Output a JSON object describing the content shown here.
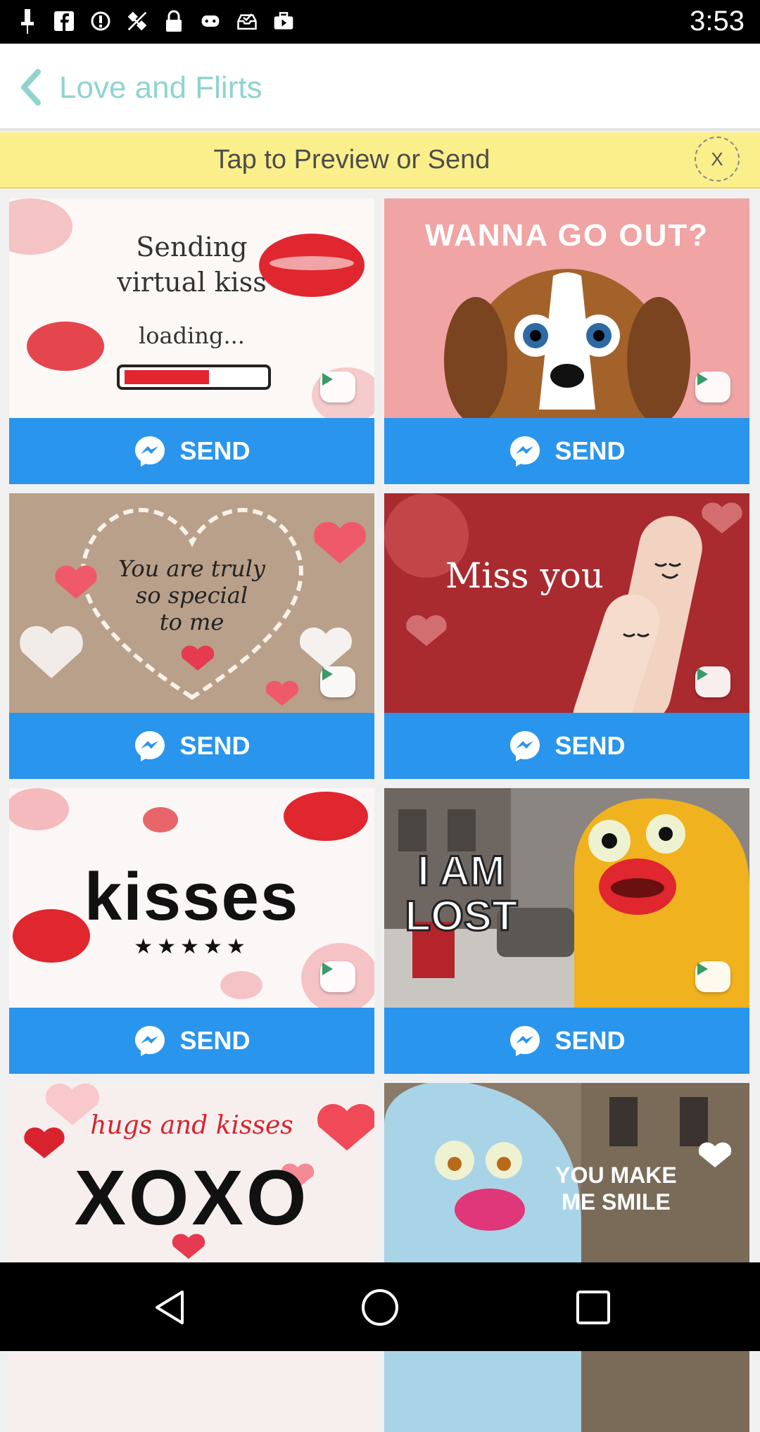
{
  "status_bar": {
    "time": "3:53",
    "icons": [
      "pin-icon",
      "facebook-icon",
      "info-icon",
      "no-gps-icon",
      "lock-icon",
      "gamepad-icon",
      "inbox-check-icon",
      "briefcase-play-icon"
    ]
  },
  "app_bar": {
    "title": "Love and Flirts"
  },
  "banner": {
    "text": "Tap to Preview or Send",
    "close_label": "X"
  },
  "cards": [
    {
      "lines": [
        "Sending",
        "virtual kiss",
        "loading..."
      ],
      "send_label": "SEND"
    },
    {
      "lines": [
        "WANNA GO OUT?"
      ],
      "send_label": "SEND"
    },
    {
      "lines": [
        "You are truly",
        "so special",
        "to me"
      ],
      "send_label": "SEND"
    },
    {
      "lines": [
        "Miss you"
      ],
      "send_label": "SEND"
    },
    {
      "lines": [
        "kisses",
        "★★★★★"
      ],
      "send_label": "SEND"
    },
    {
      "lines": [
        "I AM",
        "LOST"
      ],
      "send_label": "SEND"
    },
    {
      "lines": [
        "hugs and kisses",
        "XOXO"
      ]
    },
    {
      "lines": [
        "YOU MAKE",
        "ME SMILE"
      ]
    }
  ],
  "colors": {
    "accent": "#8fd4cf",
    "banner": "#fbef8b",
    "send_button": "#2a95ec"
  }
}
